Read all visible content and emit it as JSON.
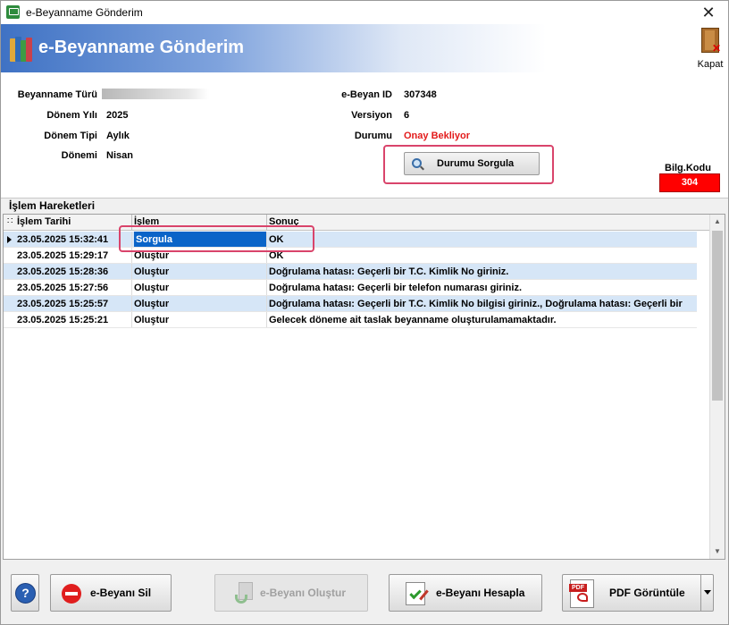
{
  "window": {
    "title": "e-Beyanname Gönderim",
    "close_glyph": "✕"
  },
  "banner": {
    "title": "e-Beyanname Gönderim",
    "close_label": "Kapat"
  },
  "info": {
    "beyanname_turu_label": "Beyanname Türü",
    "beyanname_turu_value": "",
    "donem_yili_label": "Dönem Yılı",
    "donem_yili_value": "2025",
    "donem_tipi_label": "Dönem Tipi",
    "donem_tipi_value": "Aylık",
    "donemi_label": "Dönemi",
    "donemi_value": "Nisan",
    "ebeyan_id_label": "e-Beyan ID",
    "ebeyan_id_value": "307348",
    "versiyon_label": "Versiyon",
    "versiyon_value": "6",
    "durumu_label": "Durumu",
    "durumu_value": "Onay Bekliyor",
    "durumu_color": "#e31b1b",
    "sorgula_button": "Durumu Sorgula",
    "bilg_kodu_label": "Bilg.Kodu",
    "bilg_kodu_value": "304"
  },
  "grid": {
    "group_label": "İşlem Hareketleri",
    "columns": [
      "İşlem Tarihi",
      "İşlem",
      "Sonuç"
    ],
    "rows": [
      {
        "tarih": "23.05.2025 15:32:41",
        "islem": "Sorgula",
        "sonuc": "OK",
        "selected": true
      },
      {
        "tarih": "23.05.2025 15:29:17",
        "islem": "Oluştur",
        "sonuc": "OK"
      },
      {
        "tarih": "23.05.2025 15:28:36",
        "islem": "Oluştur",
        "sonuc": "Doğrulama hatası: Geçerli bir T.C. Kimlik No giriniz."
      },
      {
        "tarih": "23.05.2025 15:27:56",
        "islem": "Oluştur",
        "sonuc": "Doğrulama hatası: Geçerli bir telefon numarası giriniz."
      },
      {
        "tarih": "23.05.2025 15:25:57",
        "islem": "Oluştur",
        "sonuc": "Doğrulama hatası: Geçerli bir T.C. Kimlik No bilgisi giriniz., Doğrulama hatası: Geçerli bir"
      },
      {
        "tarih": "23.05.2025 15:25:21",
        "islem": "Oluştur",
        "sonuc": "Gelecek döneme ait taslak beyanname oluşturulamamaktadır."
      }
    ]
  },
  "footer": {
    "help": "?",
    "sil": "e-Beyanı Sil",
    "olustur": "e-Beyanı Oluştur",
    "hesapla": "e-Beyanı Hesapla",
    "pdf": "PDF Görüntüle",
    "pdf_icon_text": "PDF"
  },
  "colors": {
    "accent": "#3f72c4",
    "highlight": "#d9446b",
    "selection": "#0a64c8",
    "alt_row": "#d6e6f7"
  }
}
